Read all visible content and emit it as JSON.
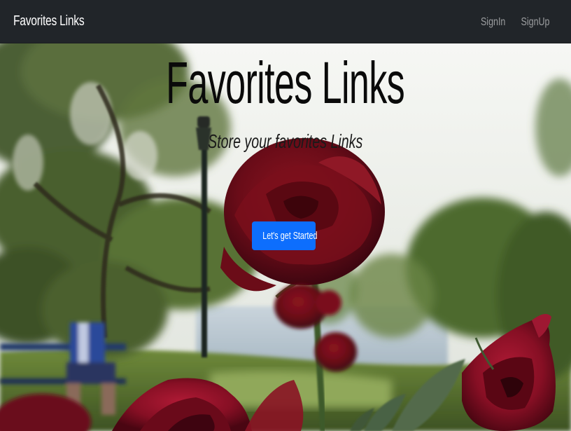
{
  "navbar": {
    "brand": "Favorites Links",
    "links": [
      "SignIn",
      "SignUp"
    ],
    "background": "#212529"
  },
  "hero": {
    "title": "Favorites Links",
    "subtitle": "Store your favorites Links",
    "cta_label": "Let's get Started",
    "cta_color": "#0d6efd",
    "background_image": "park-with-red-roses-photo"
  }
}
